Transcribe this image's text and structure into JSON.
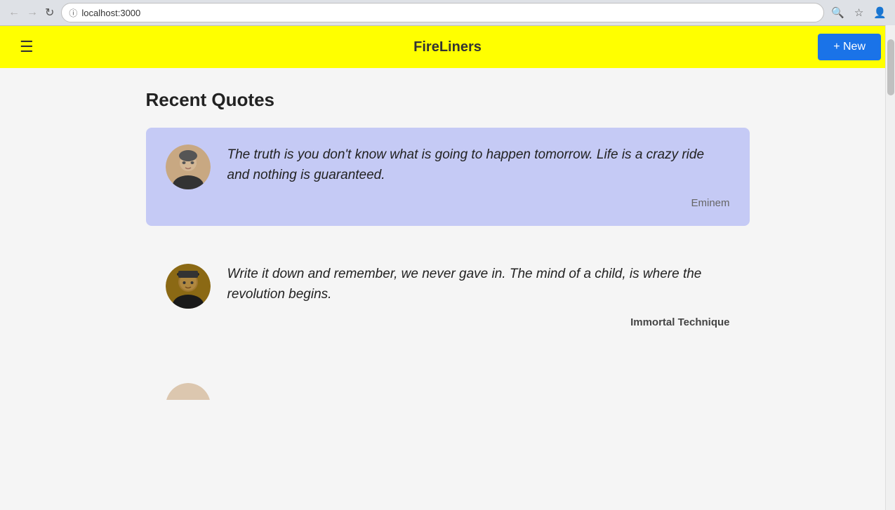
{
  "browser": {
    "url": "localhost:3000",
    "back_btn": "←",
    "forward_btn": "→",
    "reload_btn": "↺"
  },
  "navbar": {
    "hamburger_label": "☰",
    "title": "FireLiners",
    "new_button_label": "+ New"
  },
  "page": {
    "section_title": "Recent Quotes",
    "quotes": [
      {
        "id": 1,
        "text": "The truth is you don't know what is going to happen tomorrow. Life is a crazy ride and nothing is guaranteed.",
        "author": "Eminem",
        "highlighted": true,
        "author_bold": false
      },
      {
        "id": 2,
        "text": "Write it down and remember, we never gave in. The mind of a child, is where the revolution begins.",
        "author": "Immortal Technique",
        "highlighted": false,
        "author_bold": true
      }
    ]
  }
}
